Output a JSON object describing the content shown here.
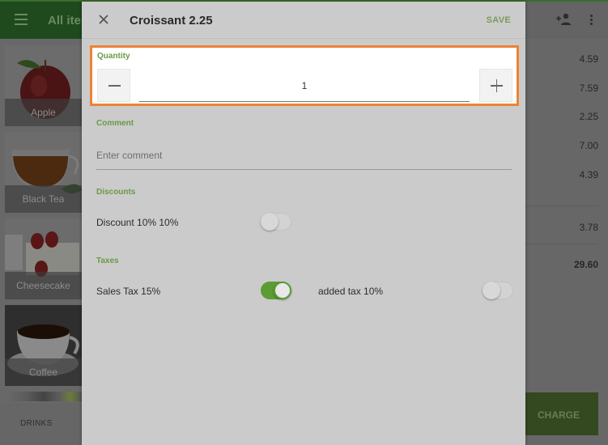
{
  "background": {
    "app_title": "All items",
    "icons": {
      "menu": "menu-icon",
      "add_customer": "add-person-icon",
      "more": "more-vert-icon"
    },
    "items": [
      {
        "name": "Apple"
      },
      {
        "name": "Black Tea"
      },
      {
        "name": "Cheesecake"
      },
      {
        "name": "Coffee"
      }
    ],
    "bottom_tab": "DRINKS",
    "ticket": {
      "line_prices": [
        "4.59",
        "7.59",
        "2.25",
        "7.00",
        "4.39"
      ],
      "tax": "3.78",
      "total": "29.60"
    },
    "charge_label": "CHARGE"
  },
  "dialog": {
    "title": "Croissant 2.25",
    "save_label": "SAVE",
    "close_icon": "close-icon",
    "quantity": {
      "label": "Quantity",
      "value": "1",
      "decrement_icon": "minus-icon",
      "increment_icon": "plus-icon"
    },
    "comment": {
      "label": "Comment",
      "placeholder": "Enter comment",
      "value": ""
    },
    "discounts": {
      "label": "Discounts",
      "items": [
        {
          "label": "Discount 10% 10%",
          "enabled": false
        }
      ]
    },
    "taxes": {
      "label": "Taxes",
      "items": [
        {
          "label": "Sales Tax 15%",
          "enabled": true
        },
        {
          "label": "added tax 10%",
          "enabled": false
        }
      ]
    }
  },
  "colors": {
    "accent_green": "#5b9c35",
    "highlight_orange": "#ee8236",
    "appbar_green_dimmed": "#1e4a1e"
  }
}
